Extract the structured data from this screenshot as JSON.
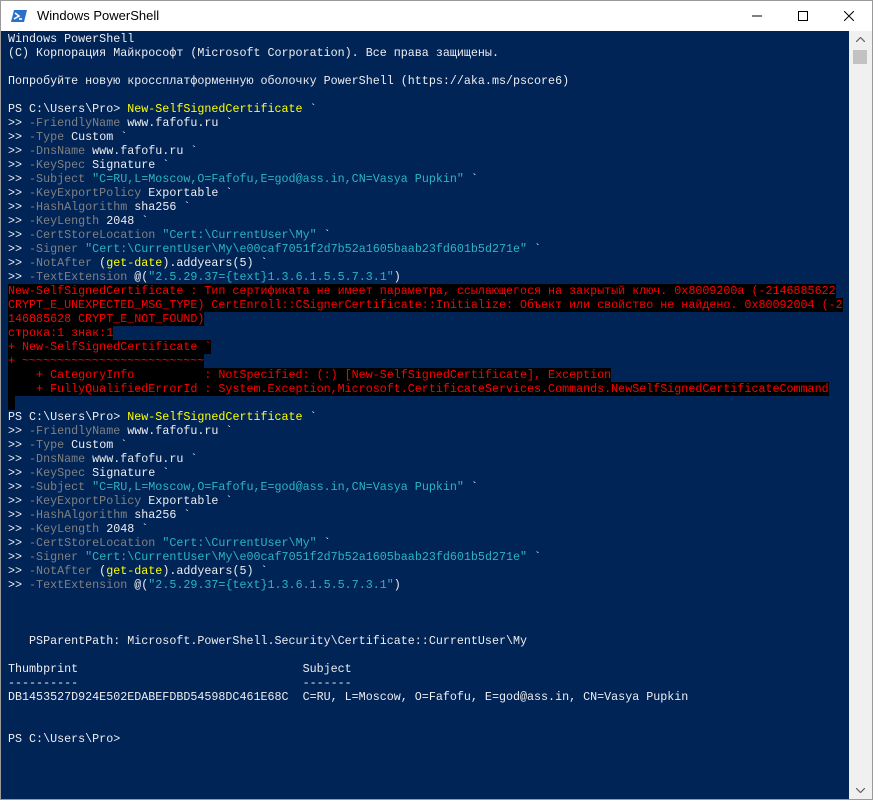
{
  "window": {
    "title": "Windows PowerShell",
    "icon": "powershell-icon",
    "controls": [
      "minimize-icon",
      "maximize-icon",
      "close-icon"
    ]
  },
  "colors": {
    "console_bg": "#012456",
    "text": "#eeedf0",
    "command": "#ffff00",
    "parameter": "#808080",
    "string": "#2bb5c0",
    "error": "#ff0000",
    "error_bg": "#000000"
  },
  "console": {
    "lines": [
      [
        {
          "t": "p",
          "s": "Windows PowerShell"
        }
      ],
      [
        {
          "t": "p",
          "s": "(C) Корпорация Майкрософт (Microsoft Corporation). Все права защищены."
        }
      ],
      [],
      [
        {
          "t": "p",
          "s": "Попробуйте новую кроссплатформенную оболочку PowerShell (https://aka.ms/pscore6)"
        }
      ],
      [],
      [
        {
          "t": "p",
          "s": "PS C:\\Users\\Pro> "
        },
        {
          "t": "cmd",
          "s": "New-SelfSignedCertificate"
        },
        {
          "t": "arg",
          "s": " `"
        }
      ],
      [
        {
          "t": "p",
          "s": ">> "
        },
        {
          "t": "prm",
          "s": "-FriendlyName"
        },
        {
          "t": "arg",
          "s": " www.fafofu.ru `"
        }
      ],
      [
        {
          "t": "p",
          "s": ">> "
        },
        {
          "t": "prm",
          "s": "-Type"
        },
        {
          "t": "arg",
          "s": " Custom `"
        }
      ],
      [
        {
          "t": "p",
          "s": ">> "
        },
        {
          "t": "prm",
          "s": "-DnsName"
        },
        {
          "t": "arg",
          "s": " www.fafofu.ru `"
        }
      ],
      [
        {
          "t": "p",
          "s": ">> "
        },
        {
          "t": "prm",
          "s": "-KeySpec"
        },
        {
          "t": "arg",
          "s": " Signature `"
        }
      ],
      [
        {
          "t": "p",
          "s": ">> "
        },
        {
          "t": "prm",
          "s": "-Subject"
        },
        {
          "t": "arg",
          "s": " "
        },
        {
          "t": "str",
          "s": "\"C=RU,L=Moscow,O=Fafofu,E=god@ass.in,CN=Vasya Pupkin\""
        },
        {
          "t": "arg",
          "s": " `"
        }
      ],
      [
        {
          "t": "p",
          "s": ">> "
        },
        {
          "t": "prm",
          "s": "-KeyExportPolicy"
        },
        {
          "t": "arg",
          "s": " Exportable `"
        }
      ],
      [
        {
          "t": "p",
          "s": ">> "
        },
        {
          "t": "prm",
          "s": "-HashAlgorithm"
        },
        {
          "t": "arg",
          "s": " sha256 `"
        }
      ],
      [
        {
          "t": "p",
          "s": ">> "
        },
        {
          "t": "prm",
          "s": "-KeyLength"
        },
        {
          "t": "arg",
          "s": " 2048 `"
        }
      ],
      [
        {
          "t": "p",
          "s": ">> "
        },
        {
          "t": "prm",
          "s": "-CertStoreLocation"
        },
        {
          "t": "arg",
          "s": " "
        },
        {
          "t": "str",
          "s": "\"Cert:\\CurrentUser\\My\""
        },
        {
          "t": "arg",
          "s": " `"
        }
      ],
      [
        {
          "t": "p",
          "s": ">> "
        },
        {
          "t": "prm",
          "s": "-Signer"
        },
        {
          "t": "arg",
          "s": " "
        },
        {
          "t": "str",
          "s": "\"Cert:\\CurrentUser\\My\\e00caf7051f2d7b52a1605baab23fd601b5d271e\""
        },
        {
          "t": "arg",
          "s": " `"
        }
      ],
      [
        {
          "t": "p",
          "s": ">> "
        },
        {
          "t": "prm",
          "s": "-NotAfter"
        },
        {
          "t": "arg",
          "s": " ("
        },
        {
          "t": "cmd",
          "s": "get-date"
        },
        {
          "t": "arg",
          "s": ").addyears(5) `"
        }
      ],
      [
        {
          "t": "p",
          "s": ">> "
        },
        {
          "t": "prm",
          "s": "-TextExtension"
        },
        {
          "t": "arg",
          "s": " @("
        },
        {
          "t": "str",
          "s": "\"2.5.29.37={text}1.3.6.1.5.5.7.3.1\""
        },
        {
          "t": "arg",
          "s": ")"
        }
      ],
      [
        {
          "t": "err",
          "s": "New-SelfSignedCertificate : Тип сертификата не имеет параметра, ссылающегося на закрытый ключ. 0x8009200a (-2146885622"
        }
      ],
      [
        {
          "t": "err",
          "s": "CRYPT_E_UNEXPECTED_MSG_TYPE) CertEnroll::CSignerCertificate::Initialize: Объект или свойство не найдено. 0x80092004 (-2"
        }
      ],
      [
        {
          "t": "err",
          "s": "146885628 CRYPT_E_NOT_FOUND)"
        }
      ],
      [
        {
          "t": "err",
          "s": "строка:1 знак:1"
        }
      ],
      [
        {
          "t": "err",
          "s": "+ New-SelfSignedCertificate `"
        }
      ],
      [
        {
          "t": "err",
          "s": "+ ~~~~~~~~~~~~~~~~~~~~~~~~~~"
        }
      ],
      [
        {
          "t": "err",
          "s": "    + CategoryInfo          : NotSpecified: (:) [New-SelfSignedCertificate], Exception"
        }
      ],
      [
        {
          "t": "err",
          "s": "    + FullyQualifiedErrorId : System.Exception,Microsoft.CertificateServices.Commands.NewSelfSignedCertificateCommand"
        }
      ],
      [
        {
          "t": "err",
          "s": " "
        }
      ],
      [
        {
          "t": "p",
          "s": "PS C:\\Users\\Pro> "
        },
        {
          "t": "cmd",
          "s": "New-SelfSignedCertificate"
        },
        {
          "t": "arg",
          "s": " `"
        }
      ],
      [
        {
          "t": "p",
          "s": ">> "
        },
        {
          "t": "prm",
          "s": "-FriendlyName"
        },
        {
          "t": "arg",
          "s": " www.fafofu.ru `"
        }
      ],
      [
        {
          "t": "p",
          "s": ">> "
        },
        {
          "t": "prm",
          "s": "-Type"
        },
        {
          "t": "arg",
          "s": " Custom `"
        }
      ],
      [
        {
          "t": "p",
          "s": ">> "
        },
        {
          "t": "prm",
          "s": "-DnsName"
        },
        {
          "t": "arg",
          "s": " www.fafofu.ru `"
        }
      ],
      [
        {
          "t": "p",
          "s": ">> "
        },
        {
          "t": "prm",
          "s": "-KeySpec"
        },
        {
          "t": "arg",
          "s": " Signature `"
        }
      ],
      [
        {
          "t": "p",
          "s": ">> "
        },
        {
          "t": "prm",
          "s": "-Subject"
        },
        {
          "t": "arg",
          "s": " "
        },
        {
          "t": "str",
          "s": "\"C=RU,L=Moscow,O=Fafofu,E=god@ass.in,CN=Vasya Pupkin\""
        },
        {
          "t": "arg",
          "s": " `"
        }
      ],
      [
        {
          "t": "p",
          "s": ">> "
        },
        {
          "t": "prm",
          "s": "-KeyExportPolicy"
        },
        {
          "t": "arg",
          "s": " Exportable `"
        }
      ],
      [
        {
          "t": "p",
          "s": ">> "
        },
        {
          "t": "prm",
          "s": "-HashAlgorithm"
        },
        {
          "t": "arg",
          "s": " sha256 `"
        }
      ],
      [
        {
          "t": "p",
          "s": ">> "
        },
        {
          "t": "prm",
          "s": "-KeyLength"
        },
        {
          "t": "arg",
          "s": " 2048 `"
        }
      ],
      [
        {
          "t": "p",
          "s": ">> "
        },
        {
          "t": "prm",
          "s": "-CertStoreLocation"
        },
        {
          "t": "arg",
          "s": " "
        },
        {
          "t": "str",
          "s": "\"Cert:\\CurrentUser\\My\""
        },
        {
          "t": "arg",
          "s": " `"
        }
      ],
      [
        {
          "t": "p",
          "s": ">> "
        },
        {
          "t": "prm",
          "s": "-Signer"
        },
        {
          "t": "arg",
          "s": " "
        },
        {
          "t": "str",
          "s": "\"Cert:\\CurrentUser\\My\\e00caf7051f2d7b52a1605baab23fd601b5d271e\""
        },
        {
          "t": "arg",
          "s": " `"
        }
      ],
      [
        {
          "t": "p",
          "s": ">> "
        },
        {
          "t": "prm",
          "s": "-NotAfter"
        },
        {
          "t": "arg",
          "s": " ("
        },
        {
          "t": "cmd",
          "s": "get-date"
        },
        {
          "t": "arg",
          "s": ").addyears(5) `"
        }
      ],
      [
        {
          "t": "p",
          "s": ">> "
        },
        {
          "t": "prm",
          "s": "-TextExtension"
        },
        {
          "t": "arg",
          "s": " @("
        },
        {
          "t": "str",
          "s": "\"2.5.29.37={text}1.3.6.1.5.5.7.3.1\""
        },
        {
          "t": "arg",
          "s": ")"
        }
      ],
      [],
      [],
      [],
      [
        {
          "t": "p",
          "s": "   PSParentPath: Microsoft.PowerShell.Security\\Certificate::CurrentUser\\My"
        }
      ],
      [],
      [
        {
          "t": "p",
          "s": "Thumbprint                                Subject"
        }
      ],
      [
        {
          "t": "p",
          "s": "----------                                -------"
        }
      ],
      [
        {
          "t": "p",
          "s": "DB1453527D924E502EDABEFDBD54598DC461E68C  C=RU, L=Moscow, O=Fafofu, E=god@ass.in, CN=Vasya Pupkin"
        }
      ],
      [],
      [],
      [
        {
          "t": "p",
          "s": "PS C:\\Users\\Pro> "
        },
        {
          "t": "cursor",
          "s": ""
        }
      ]
    ]
  }
}
